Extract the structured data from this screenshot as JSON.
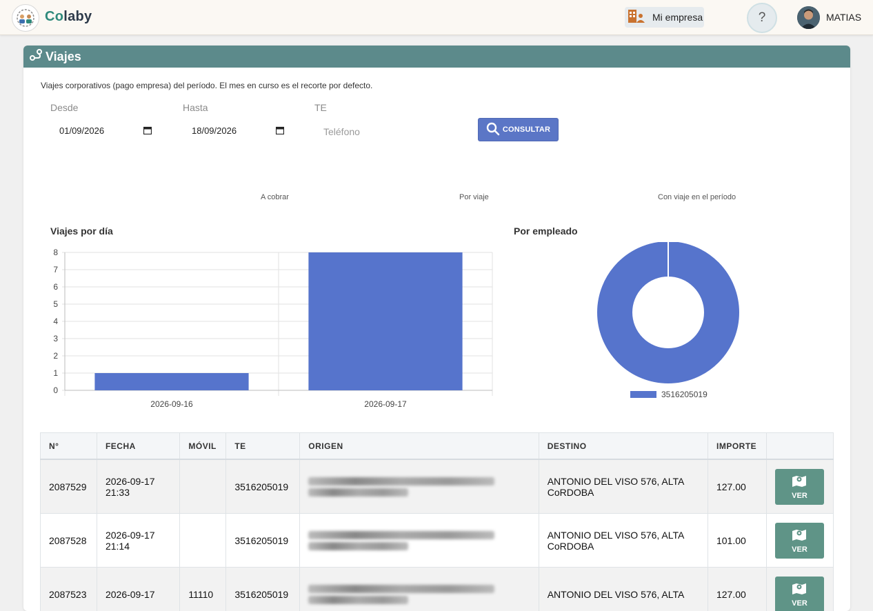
{
  "app": {
    "brand_prefix": "Co",
    "brand_suffix": "laby"
  },
  "header": {
    "empresa_label": "Mi empresa",
    "help_label": "?",
    "user_name": "MATIAS"
  },
  "page": {
    "title": "Viajes",
    "description": "Viajes corporativos (pago empresa) del período. El mes en curso es el recorte por defecto."
  },
  "filters": {
    "desde_label": "Desde",
    "desde_value": "01/09/2026",
    "hasta_label": "Hasta",
    "hasta_value": "18/09/2026",
    "te_label": "TE",
    "te_placeholder": "Teléfono",
    "consultar_label": "CONSULTAR"
  },
  "stats": {
    "a_cobrar": "A cobrar",
    "por_viaje": "Por viaje",
    "con_viaje": "Con viaje en el período"
  },
  "chart_data": [
    {
      "type": "bar",
      "title": "Viajes por día",
      "categories": [
        "2026-09-16",
        "2026-09-17"
      ],
      "values": [
        1,
        8
      ],
      "ylim": [
        0,
        8
      ],
      "yticks": [
        0,
        1,
        2,
        3,
        4,
        5,
        6,
        7,
        8
      ],
      "grid": true,
      "color": "#5674cc"
    },
    {
      "type": "pie",
      "title": "Por empleado",
      "labels": [
        "3516205019"
      ],
      "values": [
        8
      ],
      "color": "#5674cc",
      "legend": "bottom"
    }
  ],
  "table": {
    "headers": [
      "N°",
      "FECHA",
      "MÓVIL",
      "TE",
      "ORIGEN",
      "DESTINO",
      "IMPORTE",
      ""
    ],
    "ver_label": "VER",
    "rows": [
      {
        "n": "2087529",
        "fecha1": "2026-09-17",
        "fecha2": "21:33",
        "movil": "",
        "te": "3516205019",
        "destino": "ANTONIO DEL VISO 576, ALTA CoRDOBA",
        "importe": "127.00"
      },
      {
        "n": "2087528",
        "fecha1": "2026-09-17",
        "fecha2": "21:14",
        "movil": "",
        "te": "3516205019",
        "destino": "ANTONIO DEL VISO 576, ALTA CoRDOBA",
        "importe": "101.00"
      },
      {
        "n": "2087523",
        "fecha1": "2026-09-17",
        "fecha2": "",
        "movil": "11110",
        "te": "3516205019",
        "destino": "ANTONIO DEL VISO 576, ALTA",
        "importe": "127.00"
      }
    ]
  },
  "colors": {
    "header_teal": "#5c8a8b",
    "primary_blue": "#5b76c6",
    "chart_blue": "#5674cc",
    "ver_green": "#5f9487"
  }
}
